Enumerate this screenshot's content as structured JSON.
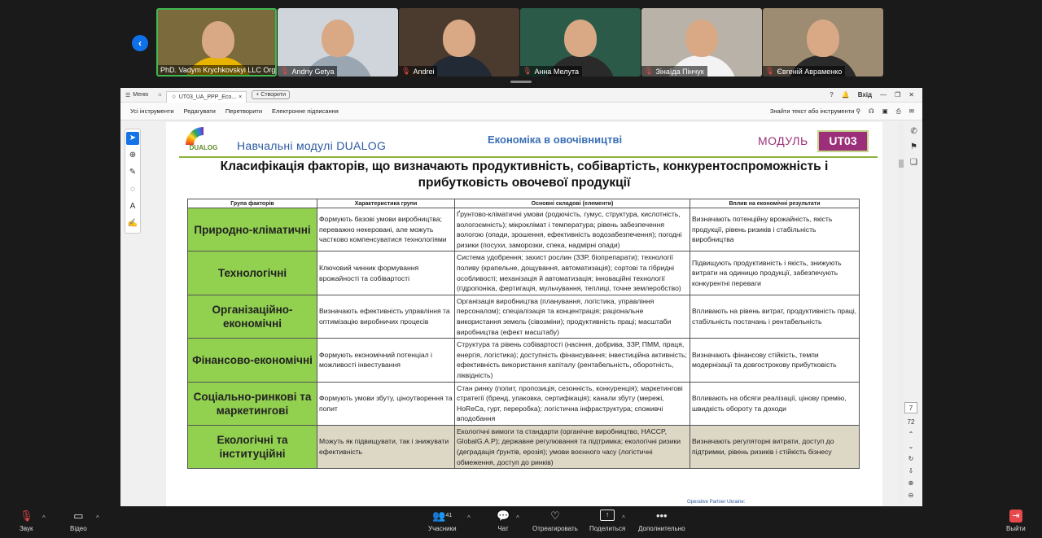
{
  "participants": [
    {
      "name": "PhD. Vadym Krychkovskyi LLC Orga...",
      "muted": false,
      "active": true,
      "bg": "#7a6a3c",
      "shirt": "#e8b400"
    },
    {
      "name": "Andriy Getya",
      "muted": true,
      "active": false,
      "bg": "#cfd5da",
      "shirt": "#9aa7b3"
    },
    {
      "name": "Andrei",
      "muted": true,
      "active": false,
      "bg": "#4b3a2e",
      "shirt": "#222a35"
    },
    {
      "name": "Анна Мелута",
      "muted": true,
      "active": false,
      "bg": "#2c5a48",
      "shirt": "#2a2a2a"
    },
    {
      "name": "Зінаїда Пінчук",
      "muted": true,
      "active": false,
      "bg": "#b9b2a8",
      "shirt": "#f3f3f3"
    },
    {
      "name": "Євгеній Авраменко",
      "muted": true,
      "active": false,
      "bg": "#9d8b72",
      "shirt": "#2a2a2a"
    }
  ],
  "viewer": {
    "menu_label": "Меню",
    "tab_label": "UT03_UA_PPP_Eco...",
    "create_label": "+ Створити",
    "login_label": "Вхід",
    "toolbar": [
      "Усі інструменти",
      "Редагувати",
      "Перетворити",
      "Електронне підписання"
    ],
    "search_label": "Знайти текст або інструменти",
    "page_number": "7",
    "page_total": "72"
  },
  "slide": {
    "logo_text": "DUALOG",
    "modules_label": "Навчальні модулі  DUALOG",
    "economics_label": "Економіка в овочівництві",
    "modul_label": "МОДУЛЬ",
    "module_code": "UT03",
    "title": "Класифікація факторів, що визначають продуктивність, собівартість, конкурентоспроможність і прибутковість овочевої продукції",
    "columns": [
      "Група факторів",
      "Характеристика групи",
      "Основні складові (елементи)",
      "Вплив на економічні результати"
    ],
    "rows": [
      {
        "group": "Природно-кліматичні",
        "desc": "Формують базові умови виробництва; переважно некеровані, але можуть частково компенсуватися технологіями",
        "elements": "Ґрунтово-кліматичні умови (родючість, гумус, структура, кислотність, вологоємність); мікроклімат і температура; рівень забезпечення вологою (опади, зрошення, ефективність водозабезпечення); погодні ризики (посухи, заморозки, спека, надмірні опади)",
        "impact": "Визначають потенційну врожайність, якість продукції, рівень ризиків і стабільність виробництва",
        "tan": false
      },
      {
        "group": "Технологічні",
        "desc": "Ключовий чинник формування врожайності та собівартості",
        "elements": "Система удобрення; захист рослин (ЗЗР, біопрепарати); технології поливу (крапельне, дощування, автоматизація); сортові та гібридні особливості; механізація й автоматизація; інноваційні технології (гідропоніка, фертигація, мульчування, теплиці, точне землеробство)",
        "impact": "Підвищують продуктивність і якість, знижують витрати на одиницю продукції, забезпечують конкурентні переваги",
        "tan": false
      },
      {
        "group": "Організаційно-економічні",
        "desc": "Визначають ефективність управління та оптимізацію виробничих процесів",
        "elements": "Організація виробництва (планування, логістика, управління персоналом); спеціалізація та концентрація; раціональне використання земель (сівозміни); продуктивність праці; масштаби виробництва (ефект масштабу)",
        "impact": "Впливають на рівень витрат, продуктивність праці, стабільність постачань і рентабельність",
        "tan": false
      },
      {
        "group": "Фінансово-економічні",
        "desc": "Формують економічний потенціал і можливості інвестування",
        "elements": "Структура та рівень собівартості (насіння, добрива, ЗЗР, ПММ, праця, енергія, логістика); доступність фінансування; інвестиційна активність; ефективність використання капіталу (рентабельність, оборотність, ліквідність)",
        "impact": "Визначають фінансову стійкість, темпи модернізації та довгострокову прибутковість",
        "tan": false
      },
      {
        "group": "Соціально-ринкові та маркетингові",
        "desc": "Формують умови збуту, ціноутворення та попит",
        "elements": "Стан ринку (попит, пропозиція, сезонність, конкуренція); маркетингові стратегії (бренд, упаковка, сертифікація); канали збуту (мережі, HoReCa, гурт, переробка); логістична інфраструктура; споживчі вподобання",
        "impact": "Впливають на обсяги реалізації, цінову премію, швидкість обороту та доходи",
        "tan": false
      },
      {
        "group": "Екологічні та інституційні",
        "desc": "Можуть як підвищувати, так і знижувати ефективність",
        "elements": "Екологічні вимоги та стандарти (органічне виробництво, HACCP, GlobalG.A.P); державне регулювання та підтримка; екологічні ризики (деградація ґрунтів, ерозія); умови воєнного часу (логістичні обмеження, доступ до ринків)",
        "impact": "Визначають регуляторні витрати, доступ до підтримки, рівень ризиків і стійкість бізнесу",
        "tan": true
      }
    ],
    "footer_partner": "Operative Partner Ukraine:"
  },
  "controls": {
    "audio": "Звук",
    "video": "Відео",
    "participants": "Учасники",
    "participants_count": "41",
    "chat": "Чат",
    "react": "Отреагировать",
    "share": "Поделиться",
    "more": "Дополнительно",
    "exit": "Выйти"
  },
  "colors": {
    "group_green": "#92d050",
    "module_purple": "#9c2f7a",
    "zoom_blue": "#0e71eb",
    "muted_red": "#e5484d"
  }
}
